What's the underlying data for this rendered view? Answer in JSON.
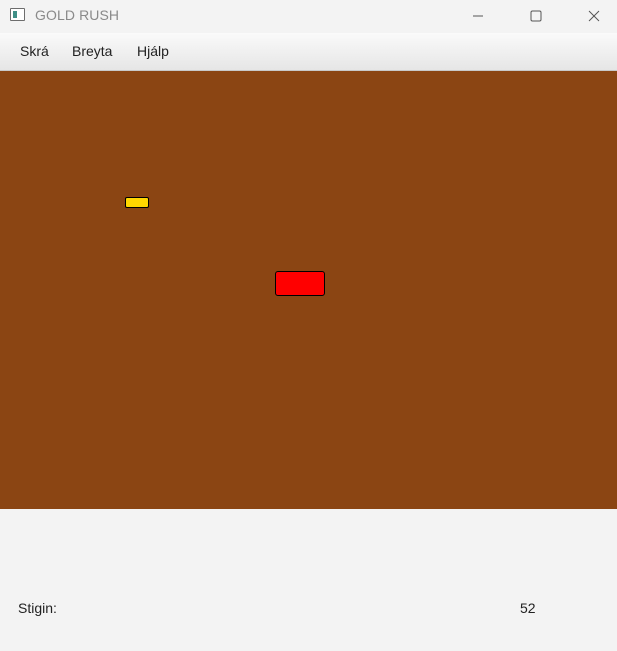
{
  "window": {
    "title": "GOLD RUSH"
  },
  "menu": {
    "items": [
      {
        "label": "Skrá"
      },
      {
        "label": "Breyta"
      },
      {
        "label": "Hjálp"
      }
    ]
  },
  "game": {
    "background_color": "#8b4513",
    "gold_color": "#ffd700",
    "digger_color": "#ff0000"
  },
  "status": {
    "score_label": "Stigin:",
    "score_value": "52"
  }
}
